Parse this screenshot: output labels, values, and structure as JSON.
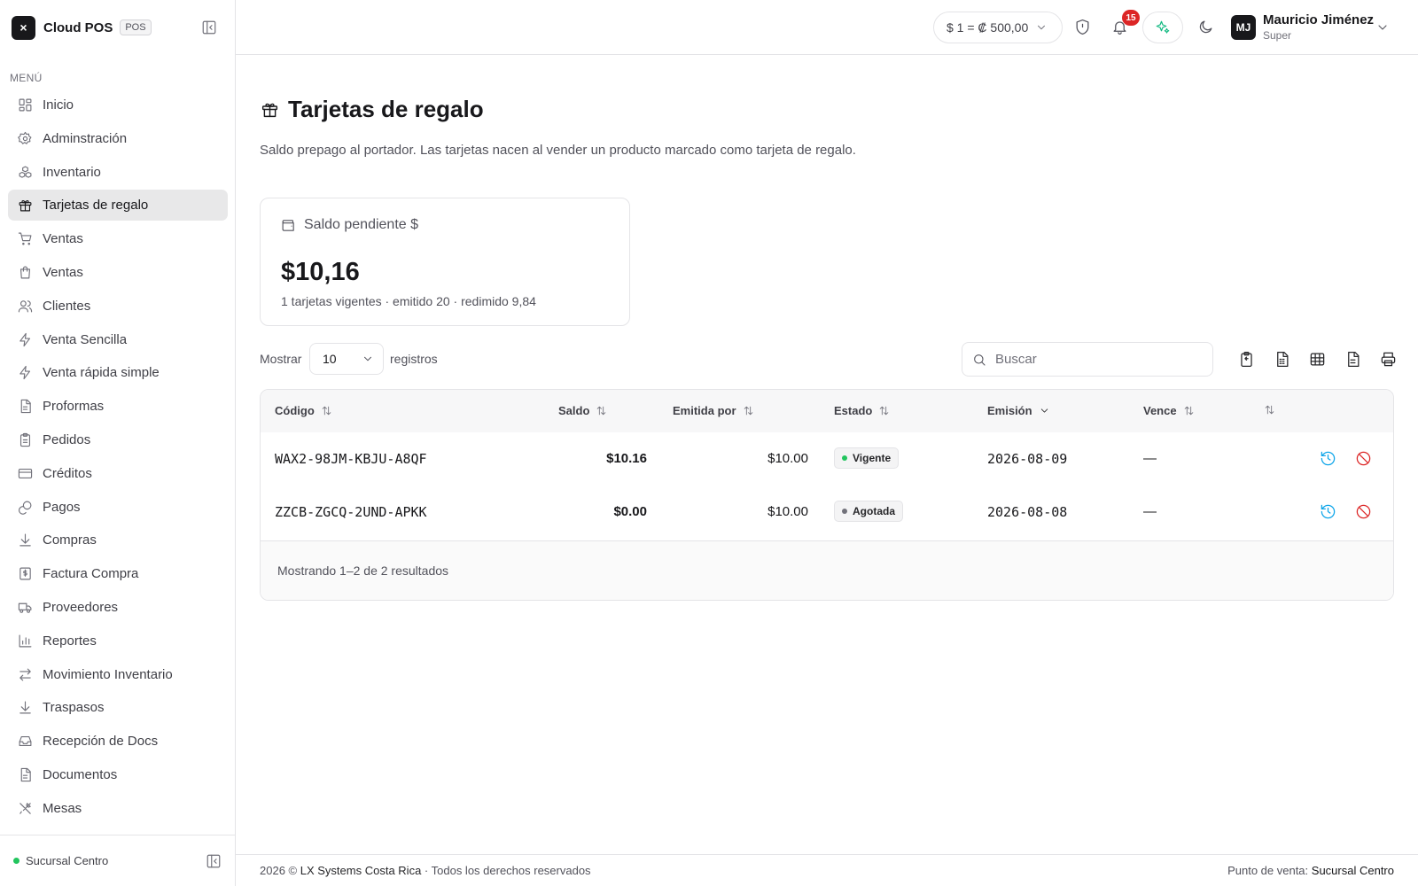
{
  "app": {
    "logo_glyph": "×",
    "name": "Cloud POS",
    "badge": "POS"
  },
  "sidebar": {
    "menu_label": "MENÚ",
    "items": [
      {
        "label": "Inicio",
        "icon": "grid-icon"
      },
      {
        "label": "Adminstración",
        "icon": "gear-icon"
      },
      {
        "label": "Inventario",
        "icon": "boxes-icon"
      },
      {
        "label": "Tarjetas de regalo",
        "icon": "gift-icon",
        "active": true
      },
      {
        "label": "Ventas",
        "icon": "cart-icon"
      },
      {
        "label": "Ventas",
        "icon": "bag-icon"
      },
      {
        "label": "Clientes",
        "icon": "users-icon"
      },
      {
        "label": "Venta Sencilla",
        "icon": "bolt-icon"
      },
      {
        "label": "Venta rápida simple",
        "icon": "bolt-icon"
      },
      {
        "label": "Proformas",
        "icon": "document-icon"
      },
      {
        "label": "Pedidos",
        "icon": "clipboard-icon"
      },
      {
        "label": "Créditos",
        "icon": "credit-card-icon"
      },
      {
        "label": "Pagos",
        "icon": "coins-icon"
      },
      {
        "label": "Compras",
        "icon": "download-icon"
      },
      {
        "label": "Factura Compra",
        "icon": "receipt-icon"
      },
      {
        "label": "Proveedores",
        "icon": "truck-icon"
      },
      {
        "label": "Reportes",
        "icon": "bar-chart-icon"
      },
      {
        "label": "Movimiento Inventario",
        "icon": "arrows-swap-icon"
      },
      {
        "label": "Traspasos",
        "icon": "download-icon"
      },
      {
        "label": "Recepción de Docs",
        "icon": "inbox-icon"
      },
      {
        "label": "Documentos",
        "icon": "document-icon"
      },
      {
        "label": "Mesas",
        "icon": "utensils-icon"
      }
    ],
    "branch": "Sucursal Centro"
  },
  "header": {
    "exchange_rate": "$ 1 =  ₡ 500,00",
    "notification_count": "15",
    "user_initials": "MJ",
    "user_name": "Mauricio Jiménez",
    "user_role": "Super"
  },
  "page": {
    "title": "Tarjetas de regalo",
    "description": "Saldo prepago al portador. Las tarjetas nacen al vender un producto marcado como tarjeta de regalo.",
    "stat": {
      "label": "Saldo pendiente $",
      "value": "$10,16",
      "subtext": "1 tarjetas vigentes · emitido 20 · redimido 9,84"
    },
    "show_label": "Mostrar",
    "page_size": "10",
    "records_label": "registros",
    "search_placeholder": "Buscar",
    "tools": [
      "copy-icon",
      "csv-icon",
      "excel-icon",
      "pdf-icon",
      "printer-icon"
    ]
  },
  "table": {
    "columns": [
      "Código",
      "Saldo",
      "Emitida por",
      "Estado",
      "Emisión",
      "Vence",
      ""
    ],
    "rows": [
      {
        "code": "WAX2-98JM-KBJU-A8QF",
        "balance": "$10.16",
        "issued": "$10.00",
        "status": "Vigente",
        "status_color": "#22c55e",
        "issue_date": "2026-08-09",
        "expires": "—"
      },
      {
        "code": "ZZCB-ZGCQ-2UND-APKK",
        "balance": "$0.00",
        "issued": "$10.00",
        "status": "Agotada",
        "status_color": "#71717a",
        "issue_date": "2026-08-08",
        "expires": "—"
      }
    ],
    "footer": "Mostrando 1–2 de 2 resultados"
  },
  "footer": {
    "year": "2026 ©",
    "company": "LX Systems Costa Rica",
    "rights": "· Todos los derechos reservados",
    "pos_label": "Punto de venta:",
    "pos_value": "Sucursal Centro"
  },
  "colors": {
    "accent_history": "#0ea5e9",
    "accent_cancel": "#dc2626",
    "ai_green": "#10b981"
  }
}
